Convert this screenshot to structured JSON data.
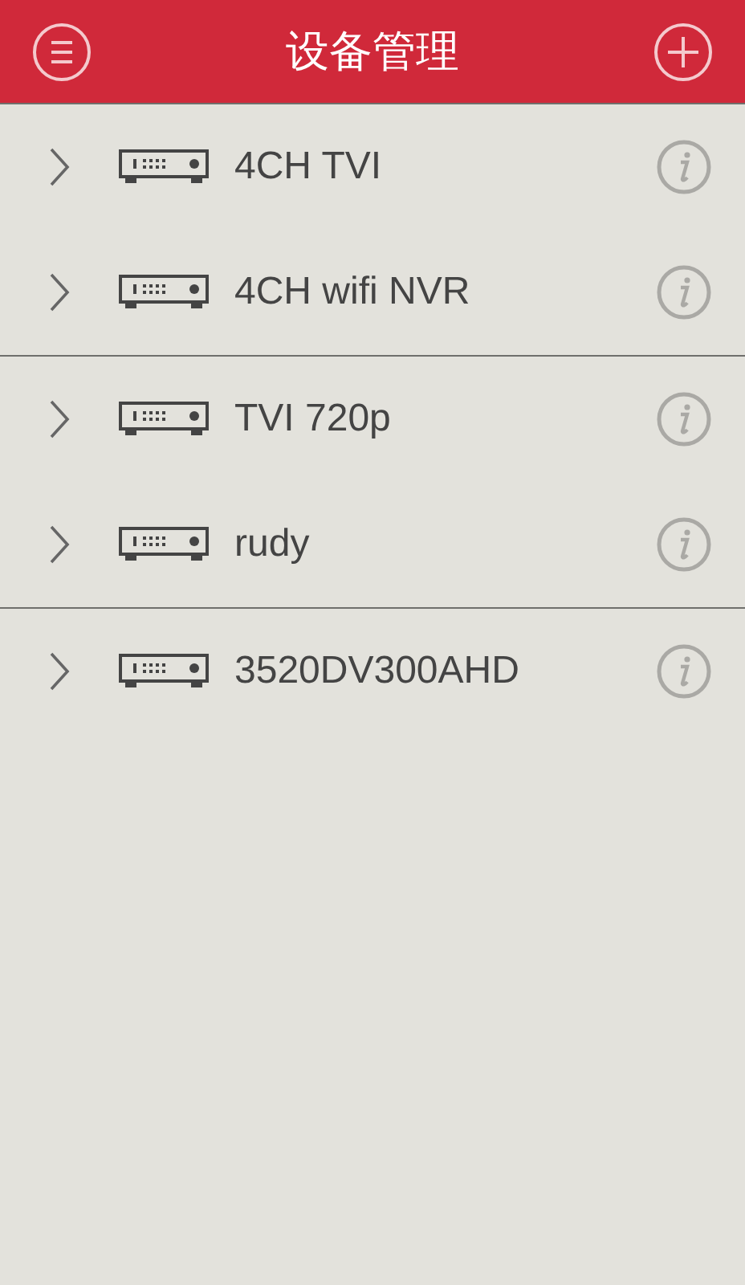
{
  "header": {
    "title": "设备管理"
  },
  "groups": [
    {
      "devices": [
        {
          "name": "4CH TVI"
        },
        {
          "name": "4CH wifi NVR"
        }
      ]
    },
    {
      "devices": [
        {
          "name": "TVI 720p"
        },
        {
          "name": "rudy"
        }
      ]
    },
    {
      "devices": [
        {
          "name": "3520DV300AHD"
        }
      ]
    }
  ]
}
